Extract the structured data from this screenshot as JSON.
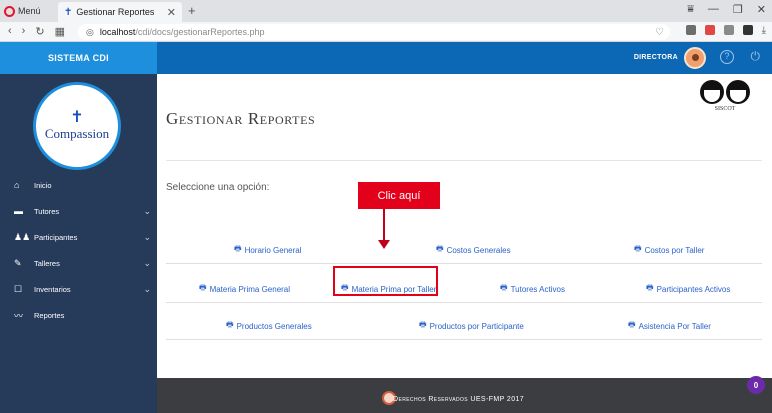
{
  "browser": {
    "menu_label": "Menú",
    "tab_title": "Gestionar Reportes",
    "url_host": "localhost",
    "url_path": "/cdi/docs/gestionarReportes.php"
  },
  "app": {
    "brand": "SISTEMA CDI",
    "logo_text": "Compassion",
    "role": "DIRECTORA",
    "siscot_label": "SISCOT"
  },
  "sidebar": {
    "items": [
      {
        "label": "Inicio",
        "icon": "home-icon"
      },
      {
        "label": "Tutores",
        "icon": "briefcase-icon"
      },
      {
        "label": "Participantes",
        "icon": "users-icon"
      },
      {
        "label": "Talleres",
        "icon": "wrench-icon"
      },
      {
        "label": "Inventarios",
        "icon": "clipboard-icon"
      },
      {
        "label": "Reportes",
        "icon": "line-chart-icon"
      }
    ]
  },
  "main": {
    "title": "Gestionar Reportes",
    "prompt": "Seleccione una opción:",
    "callout": "Clic aquí",
    "reports": {
      "row1": [
        "Horario General",
        "Costos Generales",
        "Costos por Taller"
      ],
      "row2": [
        "Materia Prima General",
        "Materia Prima por Taller",
        "Tutores Activos",
        "Participantes Activos"
      ],
      "row3": [
        "Productos Generales",
        "Productos por Participante",
        "Asistencia Por Taller"
      ]
    }
  },
  "footer": {
    "text": "Derechos Reservados UES-FMP 2017",
    "badge": "0"
  },
  "colors": {
    "sidebar_bg": "#263a5a",
    "brand_bg": "#1d8fdc",
    "topnav_bg": "#0c68b5",
    "link": "#2a62c9",
    "callout": "#e3001b",
    "footer_bg": "#3c3d41"
  }
}
